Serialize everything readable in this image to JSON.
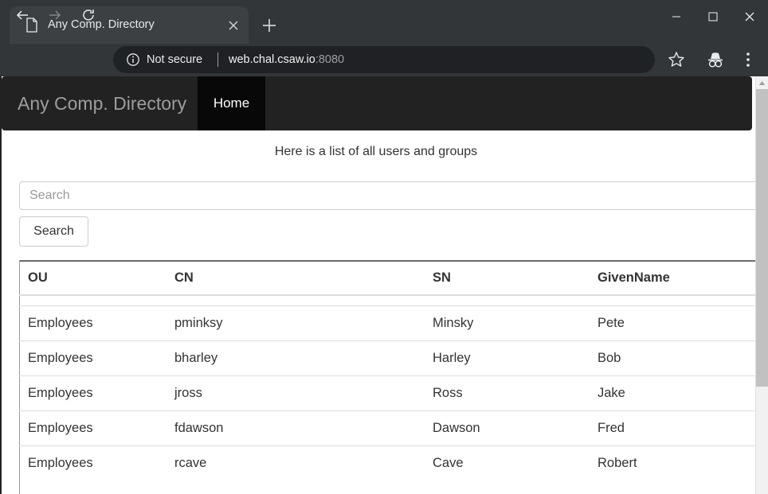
{
  "browser": {
    "tab": {
      "title": "Any Comp. Directory",
      "favicon_icon": "page-document-icon",
      "close_icon": "close-icon"
    },
    "new_tab_icon": "plus-icon",
    "window_controls": {
      "minimize_icon": "minimize-icon",
      "maximize_icon": "maximize-icon",
      "close_icon": "close-icon"
    },
    "nav": {
      "back_icon": "arrow-left-icon",
      "forward_icon": "arrow-right-icon",
      "reload_icon": "reload-icon"
    },
    "omnibox": {
      "info_icon": "info-circle-icon",
      "security_label": "Not secure",
      "url_host": "web.chal.csaw.io",
      "url_port": ":8080"
    },
    "actions": {
      "bookmark_icon": "star-icon",
      "incognito_icon": "incognito-icon",
      "menu_icon": "three-dots-vertical-icon"
    }
  },
  "page": {
    "navbar": {
      "brand": "Any Comp. Directory",
      "items": [
        {
          "label": "Home",
          "active": true
        }
      ],
      "background_color": "#222222",
      "brand_color": "#9d9d9d",
      "active_background_color": "#080808"
    },
    "lead_text": "Here is a list of all users and groups",
    "search": {
      "placeholder": "Search",
      "value": "",
      "button_label": "Search"
    },
    "table": {
      "columns": [
        "OU",
        "CN",
        "SN",
        "GivenName"
      ],
      "rows": [
        {
          "ou": "Employees",
          "cn": "pminksy",
          "sn": "Minsky",
          "givenname": "Pete"
        },
        {
          "ou": "Employees",
          "cn": "bharley",
          "sn": "Harley",
          "givenname": "Bob"
        },
        {
          "ou": "Employees",
          "cn": "jross",
          "sn": "Ross",
          "givenname": "Jake"
        },
        {
          "ou": "Employees",
          "cn": "fdawson",
          "sn": "Dawson",
          "givenname": "Fred"
        },
        {
          "ou": "Employees",
          "cn": "rcave",
          "sn": "Cave",
          "givenname": "Robert"
        }
      ]
    },
    "scrollbar": {
      "arrow_up_icon": "triangle-up-icon"
    }
  }
}
